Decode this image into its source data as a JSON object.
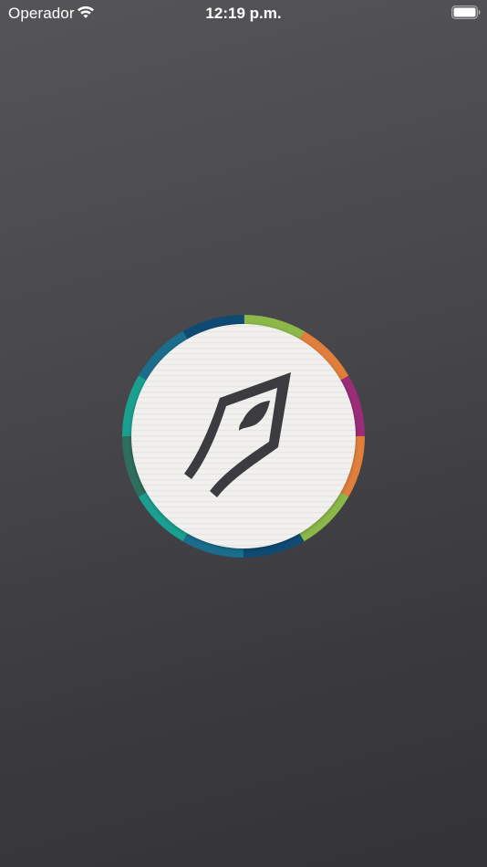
{
  "status_bar": {
    "carrier": "Operador",
    "time": "12:19 p.m.",
    "wifi_icon": "wifi-icon",
    "battery_icon": "battery-icon",
    "battery_level": 1.0
  },
  "splash": {
    "logo_icon": "pen-nib-icon",
    "ring_colors": [
      "#8cb84a",
      "#e07f3c",
      "#9b2d78",
      "#e07f3c",
      "#8cb84a",
      "#0f4a73",
      "#1b6d8c",
      "#1aa091",
      "#2e6e5e",
      "#1aa091",
      "#1b6d8c",
      "#0f4a73"
    ],
    "disc_color": "#f0efed",
    "nib_color": "#3c3c40"
  }
}
